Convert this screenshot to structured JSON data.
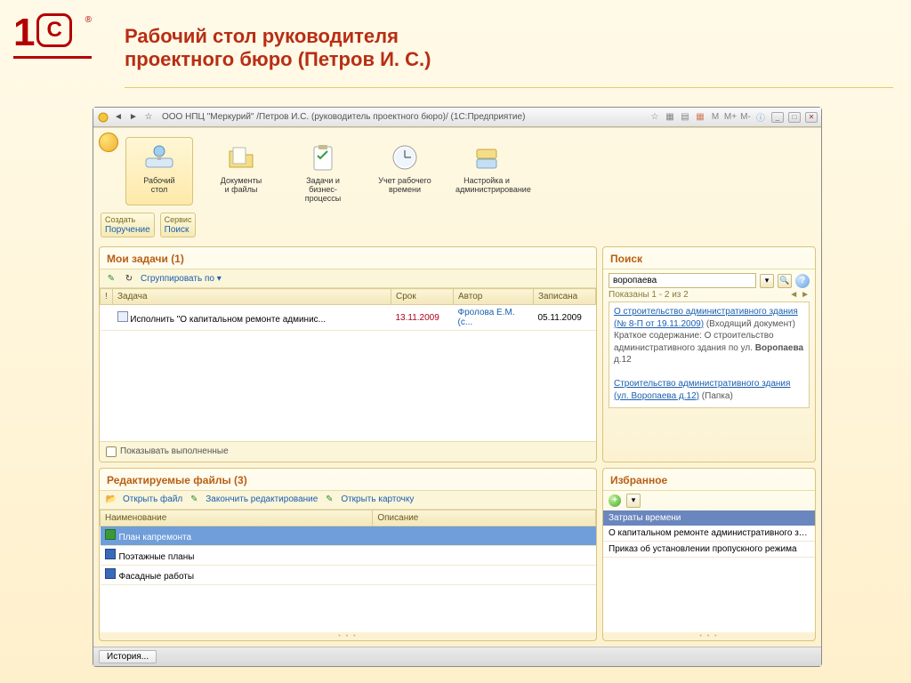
{
  "slide": {
    "title_line1": "Рабочий стол руководителя",
    "title_line2": "проектного бюро (Петров И. С.)"
  },
  "titlebar": {
    "title": "ООО НПЦ \"Меркурий\" /Петров И.С. (руководитель проектного бюро)/  (1С:Предприятие)",
    "right_items": [
      "M",
      "M+",
      "M-"
    ]
  },
  "maintabs": [
    {
      "label_l1": "Рабочий",
      "label_l2": "стол"
    },
    {
      "label_l1": "Документы",
      "label_l2": "и файлы"
    },
    {
      "label_l1": "Задачи и",
      "label_l2": "бизнес-процессы"
    },
    {
      "label_l1": "Учет рабочего",
      "label_l2": "времени"
    },
    {
      "label_l1": "Настройка и",
      "label_l2": "администрирование"
    }
  ],
  "subbar": {
    "g1_top": "Создать",
    "g1_bot": "Поручение",
    "g2_top": "Сервис",
    "g2_bot": "Поиск"
  },
  "tasks": {
    "header": "Мои задачи (1)",
    "group_label": "Сгруппировать по",
    "columns": {
      "c0": "!",
      "c1": "Задача",
      "c2": "Срок",
      "c3": "Автор",
      "c4": "Записана"
    },
    "rows": [
      {
        "name": "Исполнить \"О капитальном ремонте админис...",
        "due": "13.11.2009",
        "author": "Фролова Е.М. (с...",
        "written": "05.11.2009"
      }
    ],
    "show_done": "Показывать выполненные"
  },
  "search": {
    "header": "Поиск",
    "value": "воропаева",
    "status": "Показаны 1 - 2 из 2",
    "r1_link": "О строительство административного здания (№ 8-П от 19.11.2009)",
    "r1_kind": "(Входящий документ)",
    "r1_desc_label": "Краткое содержание:",
    "r1_desc": "О строительство административного здания по ул.",
    "r1_bold": "Воропаева",
    "r1_tail": " д.12",
    "r2_link": "Строительство административного здания (ул. Воропаева д.12)",
    "r2_kind": "(Папка)"
  },
  "files": {
    "header": "Редактируемые файлы (3)",
    "btn_open": "Открыть файл",
    "btn_finish": "Закончить редактирование",
    "btn_card": "Открыть карточку",
    "columns": {
      "c0": "Наименование",
      "c1": "Описание"
    },
    "rows": [
      {
        "name": "План капремонта",
        "sel": true,
        "icon": "xls"
      },
      {
        "name": "Поэтажные планы",
        "icon": "doc"
      },
      {
        "name": "Фасадные работы",
        "icon": "doc"
      }
    ]
  },
  "fav": {
    "header": "Избранное",
    "group": "Затраты времени",
    "rows": [
      "О капитальном ремонте административного зда...",
      "Приказ об установлении пропускного режима"
    ]
  },
  "footer": {
    "history": "История..."
  }
}
